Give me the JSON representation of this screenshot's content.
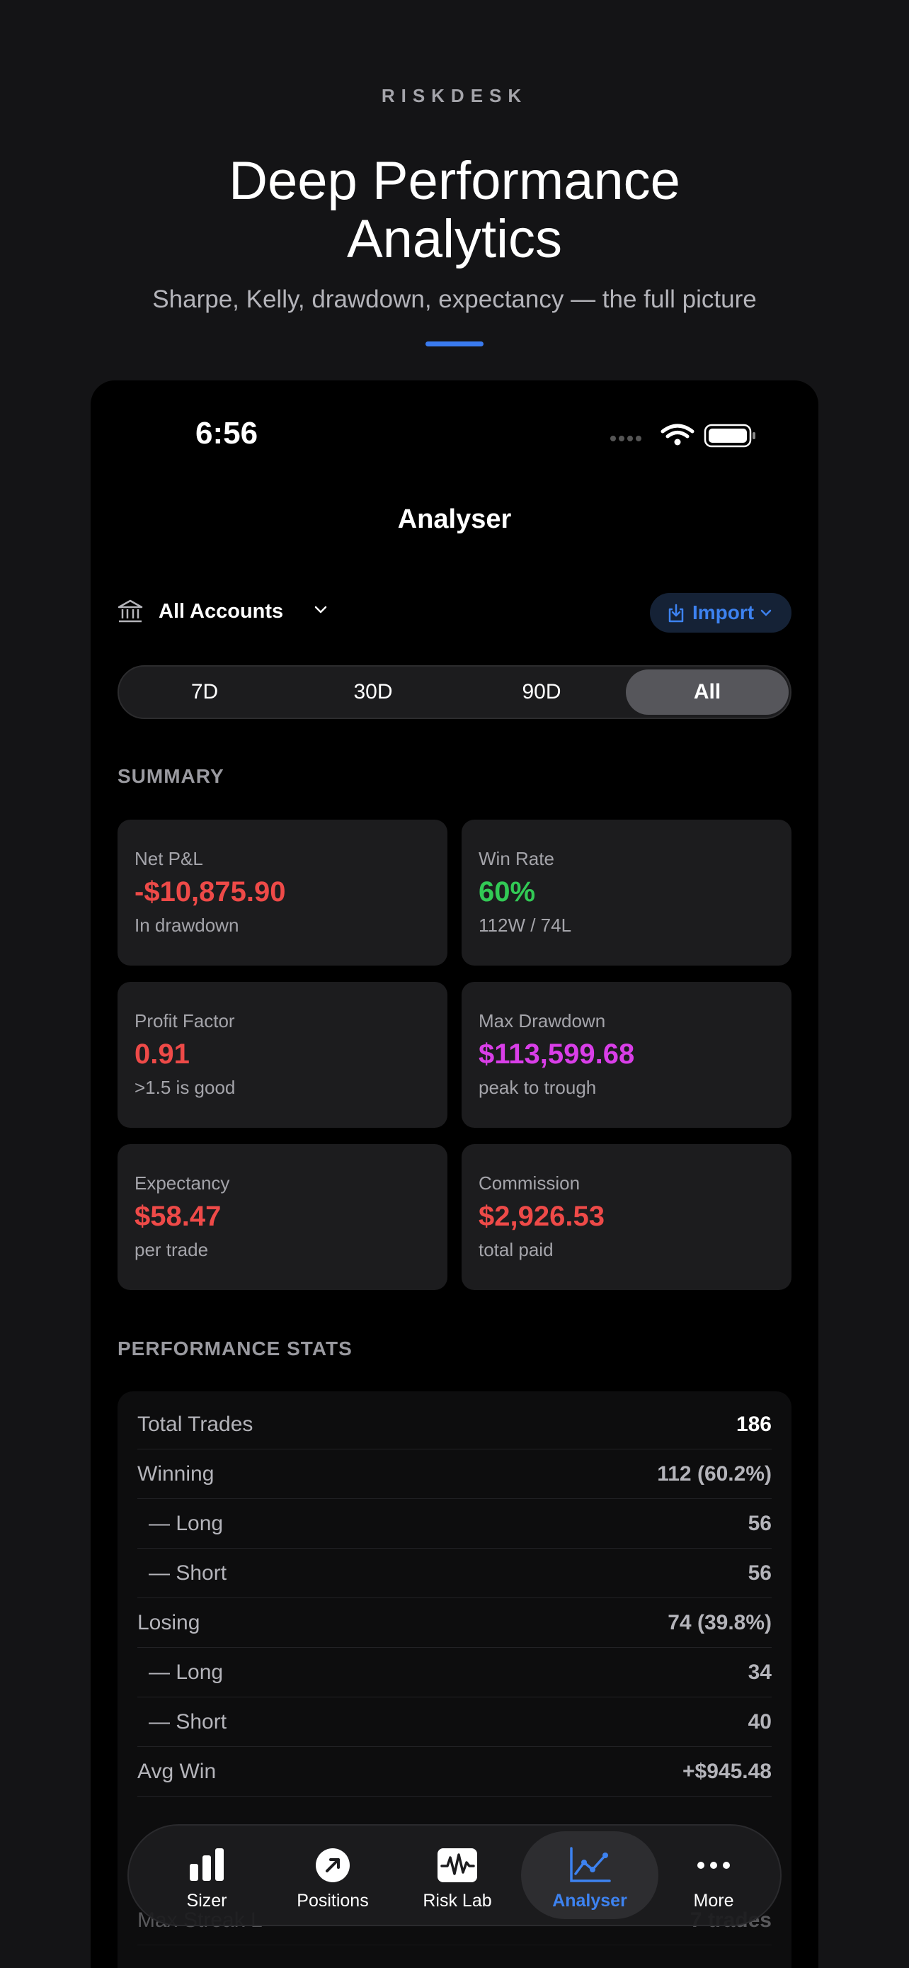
{
  "brand": "RISKDESK",
  "headline": {
    "line1": "Deep Performance",
    "line2": "Analytics"
  },
  "subhead": "Sharpe, Kelly, drawdown, expectancy — the full picture",
  "status": {
    "time": "6:56"
  },
  "nav_title": "Analyser",
  "account": {
    "label": "All Accounts",
    "icon": "bank-icon"
  },
  "import_button": {
    "label": "Import",
    "icon": "import-icon"
  },
  "range_tabs": [
    {
      "label": "7D",
      "active": false
    },
    {
      "label": "30D",
      "active": false
    },
    {
      "label": "90D",
      "active": false
    },
    {
      "label": "All",
      "active": true
    }
  ],
  "summary": {
    "title": "SUMMARY",
    "cards": [
      {
        "label": "Net P&L",
        "value": "-$10,875.90",
        "sub": "In drawdown",
        "color": "#ee4a48"
      },
      {
        "label": "Win Rate",
        "value": "60%",
        "sub": "112W / 74L",
        "color": "#32c955"
      },
      {
        "label": "Profit Factor",
        "value": "0.91",
        "sub": ">1.5 is good",
        "color": "#ee4a48"
      },
      {
        "label": "Max Drawdown",
        "value": "$113,599.68",
        "sub": "peak to trough",
        "color": "#d93ee8"
      },
      {
        "label": "Expectancy",
        "value": "$58.47",
        "sub": "per trade",
        "color": "#ee4a48"
      },
      {
        "label": "Commission",
        "value": "$2,926.53",
        "sub": "total paid",
        "color": "#ee4a48"
      }
    ]
  },
  "stats": {
    "title": "PERFORMANCE STATS",
    "rows": [
      {
        "label": "Total Trades",
        "value": "186"
      },
      {
        "label": "Winning",
        "value": "112 (60.2%)"
      },
      {
        "label": "— Long",
        "value": "56"
      },
      {
        "label": "— Short",
        "value": "56"
      },
      {
        "label": "Losing",
        "value": "74 (39.8%)"
      },
      {
        "label": "— Long",
        "value": "34"
      },
      {
        "label": "— Short",
        "value": "40"
      },
      {
        "label": "Avg Win",
        "value": "+$945.48"
      },
      {
        "label": "Max Streak L",
        "value": "7 trades"
      }
    ]
  },
  "tabbar": [
    {
      "label": "Sizer",
      "icon": "bar-chart-icon",
      "active": false
    },
    {
      "label": "Positions",
      "icon": "arrow-up-right-circle-icon",
      "active": false
    },
    {
      "label": "Risk Lab",
      "icon": "waveform-icon",
      "active": false
    },
    {
      "label": "Analyser",
      "icon": "line-chart-icon",
      "active": true
    },
    {
      "label": "More",
      "icon": "ellipsis-icon",
      "active": false
    }
  ],
  "colors": {
    "accent": "#3a7bf0",
    "negative": "#ee4a48",
    "positive": "#32c955",
    "drawdown": "#d93ee8"
  }
}
